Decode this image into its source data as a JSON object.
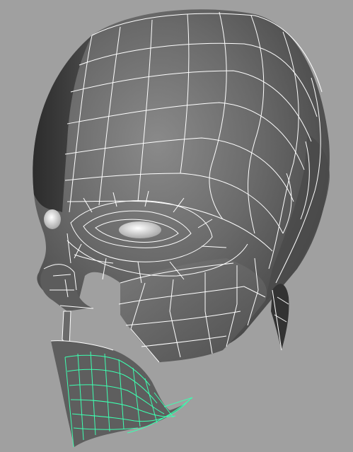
{
  "viewport": {
    "background": "#a0a0a0",
    "shading": "smooth-shaded-gray",
    "wireframe_color": "#ffffff",
    "selection_color": "#3dffb0"
  },
  "model": {
    "object": "head-mesh",
    "display": "wireframe-on-shaded",
    "selected_region": "lower-lip-and-chin"
  }
}
